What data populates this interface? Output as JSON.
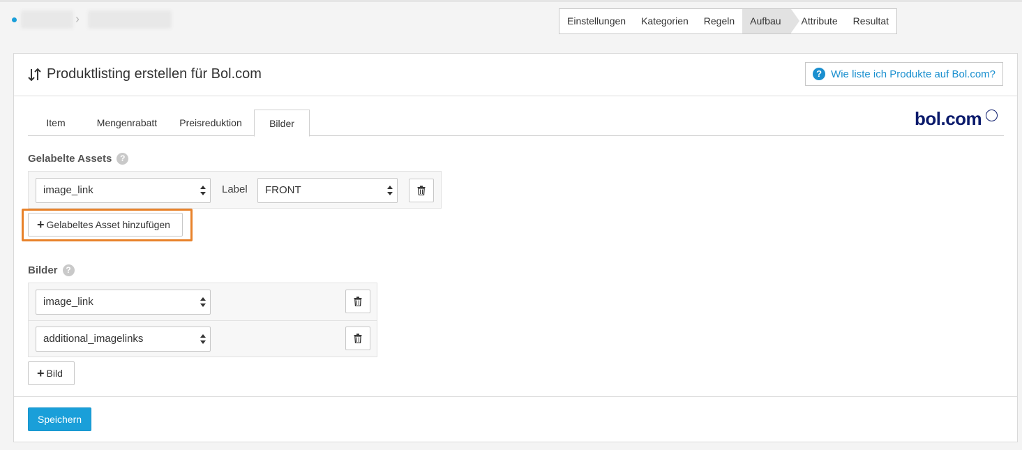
{
  "steps": [
    "Einstellungen",
    "Kategorien",
    "Regeln",
    "Aufbau",
    "Attribute",
    "Resultat"
  ],
  "active_step": "Aufbau",
  "header": {
    "title": "Produktlisting erstellen für Bol.com",
    "help_link": "Wie liste ich Produkte auf Bol.com?",
    "title_icon": "sort-arrows-icon"
  },
  "tabs": [
    "Item",
    "Mengenrabatt",
    "Preisreduktion",
    "Bilder"
  ],
  "active_tab": "Bilder",
  "logo": {
    "text": "bol.com"
  },
  "labeled_assets": {
    "label": "Gelabelte Assets",
    "rows": [
      {
        "field": "image_link",
        "label_caption": "Label",
        "label_value": "FRONT"
      }
    ],
    "add_button": "Gelabeltes Asset hinzufügen"
  },
  "images": {
    "label": "Bilder",
    "rows": [
      {
        "field": "image_link"
      },
      {
        "field": "additional_imagelinks"
      }
    ],
    "add_button": "Bild"
  },
  "save_button": "Speichern",
  "colors": {
    "accent": "#1a9fd9",
    "highlight": "#e8822a",
    "logo": "#0a1a6b"
  }
}
